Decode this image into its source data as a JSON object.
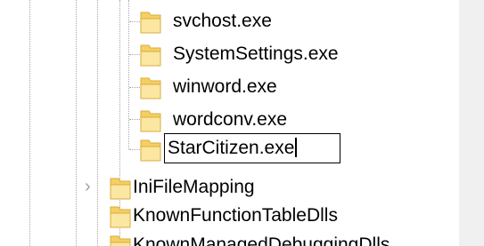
{
  "tree": {
    "children": [
      {
        "label": "svchost.exe",
        "icon": "folder-icon"
      },
      {
        "label": "SystemSettings.exe",
        "icon": "folder-icon"
      },
      {
        "label": "winword.exe",
        "icon": "folder-icon"
      },
      {
        "label": "wordconv.exe",
        "icon": "folder-icon"
      },
      {
        "label": "StarCitizen.exe",
        "icon": "folder-icon",
        "state": "renaming"
      }
    ],
    "siblings": [
      {
        "label": "IniFileMapping",
        "icon": "folder-icon",
        "expander": "chevron-right-icon",
        "expander_glyph": "›"
      },
      {
        "label": "KnownFunctionTableDlls",
        "icon": "folder-icon"
      },
      {
        "label": "KnownManagedDebuggingDlls",
        "icon": "folder-icon"
      }
    ]
  },
  "colors": {
    "folder_body": "#f5cf63",
    "folder_front": "#fbe7a2",
    "folder_outline": "#d9ac3c",
    "guide_lines": "#a8a8a8",
    "scroll_track": "#f0f0f0"
  }
}
